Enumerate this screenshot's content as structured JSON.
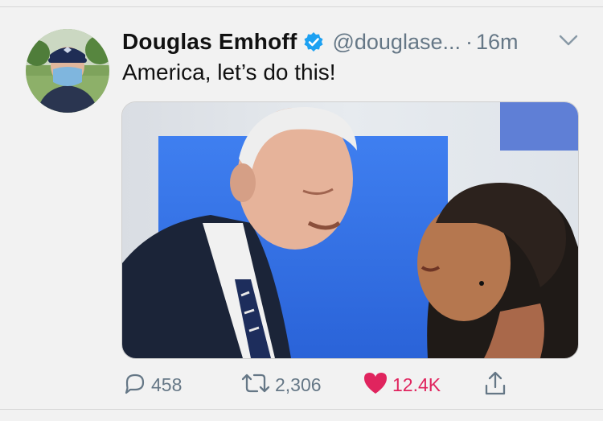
{
  "tweet": {
    "author_name": "Douglas Emhoff",
    "handle": "@douglase...",
    "separator": "·",
    "time": "16m",
    "text": "America, let’s do this!"
  },
  "actions": {
    "reply_count": "458",
    "retweet_count": "2,306",
    "like_count": "12.4K"
  },
  "colors": {
    "verified_blue": "#1da1f2",
    "like_pink": "#e0245e",
    "meta_gray": "#657786"
  },
  "icons": [
    "verified-badge-icon",
    "chevron-down-icon",
    "reply-icon",
    "retweet-icon",
    "heart-icon",
    "share-icon"
  ]
}
